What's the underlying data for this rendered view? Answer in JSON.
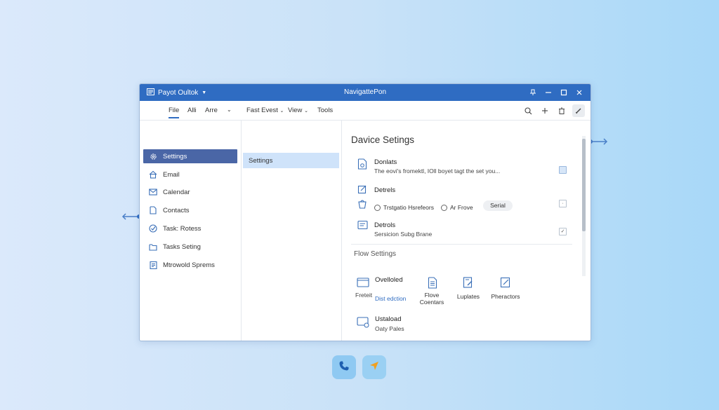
{
  "window": {
    "app_title": "Payot Oultok",
    "center_title": "NavigattePon",
    "accent_color": "#2f6cc2"
  },
  "menu": {
    "items": [
      "File",
      "Alli",
      "Arre",
      "Fast Evest",
      "View",
      "Tools"
    ]
  },
  "sidebar": {
    "items": [
      {
        "label": "Settings",
        "icon": "gear-icon"
      },
      {
        "label": "Email",
        "icon": "home-icon"
      },
      {
        "label": "Calendar",
        "icon": "mail-icon"
      },
      {
        "label": "Contacts",
        "icon": "document-icon"
      },
      {
        "label": "Task: Rotess",
        "icon": "check-circle-icon"
      },
      {
        "label": "Tasks Seting",
        "icon": "folder-icon"
      },
      {
        "label": "Mtrowold Sprems",
        "icon": "clipboard-icon"
      }
    ]
  },
  "subpanel": {
    "selected": "Settings"
  },
  "device_settings": {
    "title": "Davice Setings",
    "rows": [
      {
        "title": "Donlats",
        "desc": "The eovi's fromektl, IOll boyet tagt the set you..."
      },
      {
        "title": "Detrels",
        "radio1": "Trstgatio Hsrefeors",
        "radio2": "Ar Frove",
        "pill": "Serial"
      },
      {
        "title": "Detrols",
        "desc": "Sersicion Subg Brane"
      }
    ]
  },
  "flow_settings": {
    "title": "Flow Settings",
    "overloaded_label": "Ovelloled",
    "freteit_label": "Freteit",
    "link_label": "Dist edction",
    "grid": [
      {
        "label_line1": "Flove",
        "label_line2": "Coentars",
        "icon": "document-lines-icon"
      },
      {
        "label_line1": "Luplates",
        "label_line2": "",
        "icon": "edit-document-icon"
      },
      {
        "label_line1": "Pheractors",
        "label_line2": "",
        "icon": "pencil-note-icon"
      }
    ],
    "upload_title": "Ustaload",
    "upload_desc": "Oaty Pales"
  }
}
